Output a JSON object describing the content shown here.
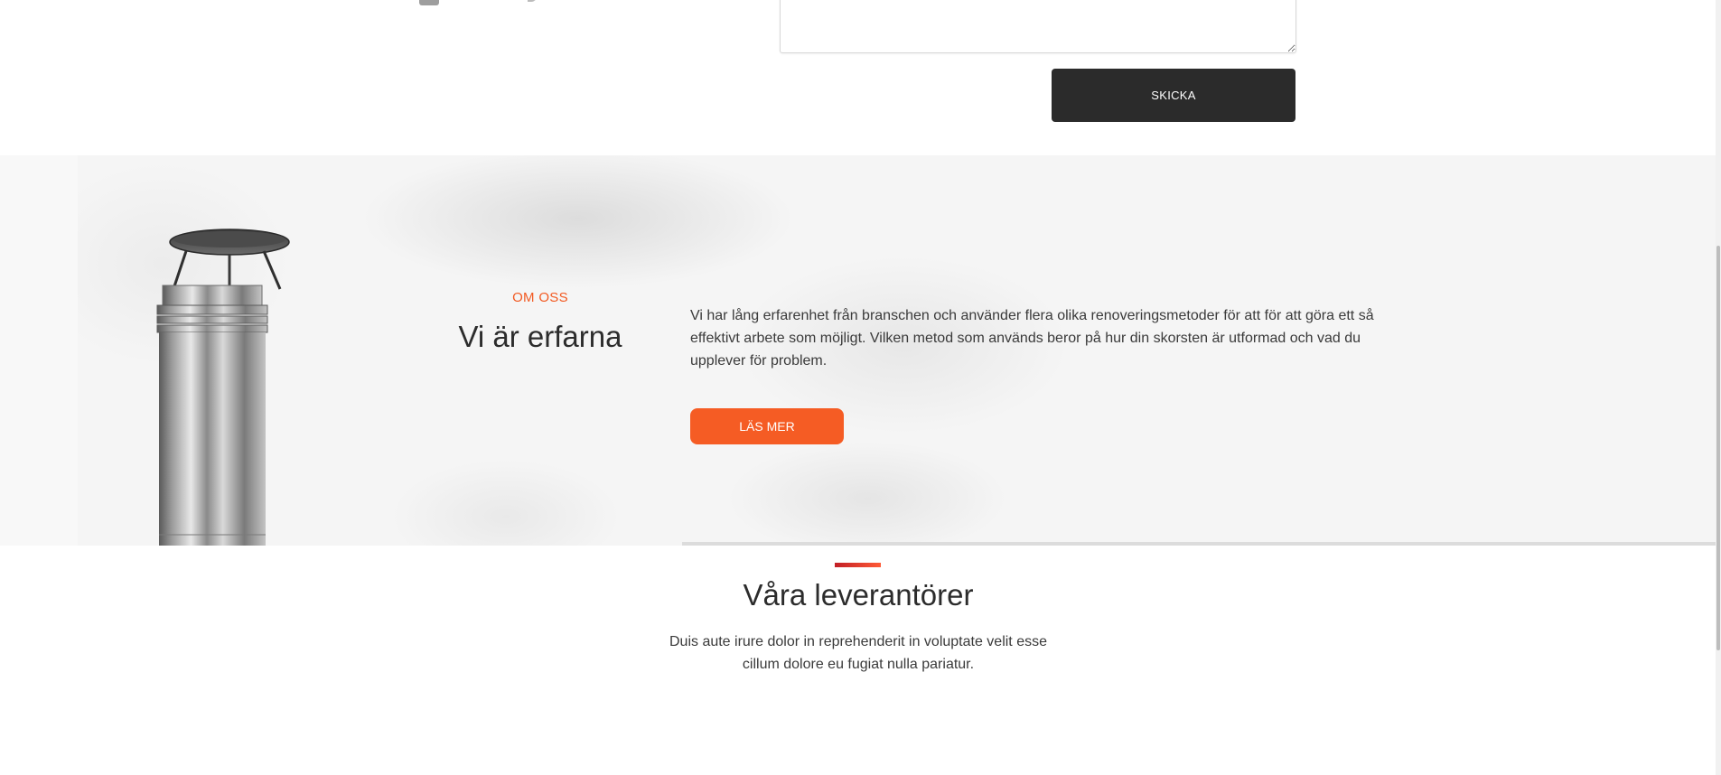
{
  "contact_form": {
    "message_value": "",
    "submit_label": "SKICKA"
  },
  "about": {
    "eyebrow": "OM OSS",
    "title": "Vi är erfarna",
    "body": "Vi har lång erfarenhet från branschen och använder flera olika renoveringsmetoder för att för att göra ett så effektivt arbete som möjligt. Vilken metod som används beror på hur din skorsten är utformad och vad du upplever för problem.",
    "button_label": "LÄS MER",
    "image_icon": "chimney-image"
  },
  "suppliers": {
    "title": "Våra leverantörer",
    "subtitle": "Duis aute irure dolor in reprehenderit in voluptate velit esse cillum dolore eu fugiat nulla pariatur."
  },
  "colors": {
    "accent": "#f55c24",
    "eyebrow": "#f25a22",
    "dark_button": "#2b2b2b",
    "divider_accent_start": "#c21f26",
    "divider_accent_end": "#ff5a36"
  }
}
